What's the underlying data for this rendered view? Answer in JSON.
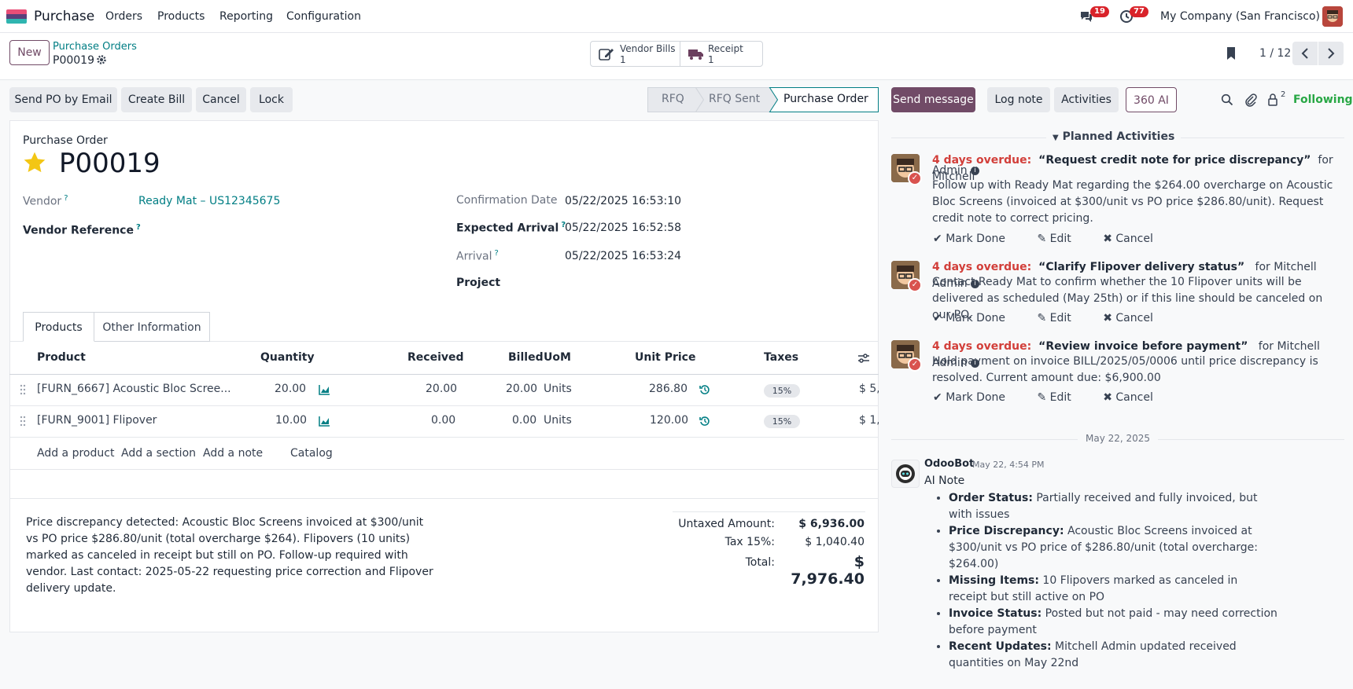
{
  "nav": {
    "app_title": "Purchase",
    "menu": [
      "Orders",
      "Products",
      "Reporting",
      "Configuration"
    ],
    "messages_count": "19",
    "activities_count": "77",
    "company": "My Company (San Francisco)"
  },
  "control": {
    "new_label": "New",
    "breadcrumb_parent": "Purchase Orders",
    "breadcrumb_current": "P00019",
    "vendor_bills_label": "Vendor Bills",
    "vendor_bills_count": "1",
    "receipt_label": "Receipt",
    "receipt_count": "1",
    "pager": "1 / 12"
  },
  "actions": [
    "Send PO by Email",
    "Create Bill",
    "Cancel",
    "Lock"
  ],
  "statusbar": [
    "RFQ",
    "RFQ Sent",
    "Purchase Order"
  ],
  "form": {
    "heading": "Purchase Order",
    "name": "P00019",
    "vendor_label": "Vendor",
    "vendor_value": "Ready Mat – US12345675",
    "vendor_ref_label": "Vendor Reference",
    "confirmation_label": "Confirmation Date",
    "confirmation_value": "05/22/2025 16:53:10",
    "expected_label": "Expected Arrival",
    "expected_value": "05/22/2025 16:52:58",
    "arrival_label": "Arrival",
    "arrival_value": "05/22/2025 16:53:24",
    "project_label": "Project"
  },
  "tabs": [
    "Products",
    "Other Information"
  ],
  "table": {
    "headers": [
      "Product",
      "Quantity",
      "Received",
      "Billed",
      "UoM",
      "Unit Price",
      "Taxes"
    ],
    "rows": [
      {
        "product": "[FURN_6667] Acoustic Bloc Scree...",
        "quantity": "20.00",
        "received": "20.00",
        "billed": "20.00",
        "uom": "Units",
        "price": "286.80",
        "tax": "15%",
        "subtotal": "$ 5,"
      },
      {
        "product": "[FURN_9001] Flipover",
        "quantity": "10.00",
        "received": "0.00",
        "billed": "0.00",
        "uom": "Units",
        "price": "120.00",
        "tax": "15%",
        "subtotal": "$ 1,"
      }
    ],
    "add_links": [
      "Add a product",
      "Add a section",
      "Add a note",
      "Catalog"
    ]
  },
  "notes": "Price discrepancy detected: Acoustic Bloc Screens invoiced at $300/unit vs PO price $286.80/unit (total overcharge $264). Flipovers (10 units) marked as canceled in receipt but still on PO. Follow-up required with vendor. Last contact: 2025-05-22 requesting price correction and Flipover delivery update.",
  "totals": {
    "untaxed_label": "Untaxed Amount:",
    "untaxed_value": "$ 6,936.00",
    "tax_label": "Tax 15%:",
    "tax_value": "$ 1,040.40",
    "total_label": "Total:",
    "total_value": "$ 7,976.40"
  },
  "chatter": {
    "send_message": "Send message",
    "log_note": "Log note",
    "activities": "Activities",
    "ai_button": "360 AI",
    "followers_count": "2",
    "following": "Following",
    "planned_header": "Planned Activities",
    "activity_items": [
      {
        "overdue": "4 days overdue:",
        "title": "“Request credit note for price discrepancy”",
        "for": "for Mitchell",
        "for2": "Admin",
        "text": "Follow up with Ready Mat regarding the $264.00 overcharge on Acoustic Bloc Screens (invoiced at $300/unit vs PO price $286.80/unit). Request credit note to correct pricing."
      },
      {
        "overdue": "4 days overdue:",
        "title": "“Clarify Flipover delivery status”",
        "for": "for Mitchell Admin",
        "text": "Contact Ready Mat to confirm whether the 10 Flipover units will be delivered as scheduled (May 25th) or if this line should be canceled on our PO."
      },
      {
        "overdue": "4 days overdue:",
        "title": "“Review invoice before payment”",
        "for": "for Mitchell Admin",
        "text": "Hold payment on invoice BILL/2025/05/0006 until price discrepancy is resolved. Current amount due: $6,900.00"
      }
    ],
    "mark_done": "Mark Done",
    "edit": "Edit",
    "cancel": "Cancel",
    "date_sep": "May 22, 2025",
    "msg_author": "OdooBot",
    "msg_time": "May 22, 4:54 PM",
    "msg_title": "AI Note",
    "msg_items": [
      {
        "k": "Order Status:",
        "v": " Partially received and fully invoiced, but with issues"
      },
      {
        "k": "Price Discrepancy:",
        "v": " Acoustic Bloc Screens invoiced at $300/unit vs PO price of $286.80/unit (total overcharge: $264.00)"
      },
      {
        "k": "Missing Items:",
        "v": " 10 Flipovers marked as canceled in receipt but still active on PO"
      },
      {
        "k": "Invoice Status:",
        "v": " Posted but not paid - may need correction before payment"
      },
      {
        "k": "Recent Updates:",
        "v": " Mitchell Admin updated received quantities on May 22nd"
      }
    ]
  }
}
